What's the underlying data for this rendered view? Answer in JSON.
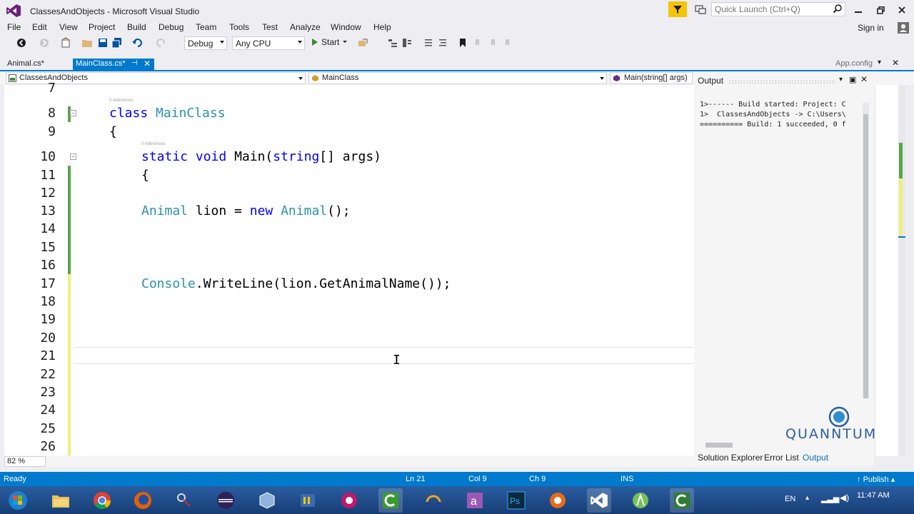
{
  "window": {
    "title": "ClassesAndObjects - Microsoft Visual Studio",
    "quick_launch_placeholder": "Quick Launch (Ctrl+Q)",
    "sign_in": "Sign in"
  },
  "menu": [
    "File",
    "Edit",
    "View",
    "Project",
    "Build",
    "Debug",
    "Team",
    "Tools",
    "Test",
    "Analyze",
    "Window",
    "Help"
  ],
  "toolbar": {
    "configuration": "Debug",
    "platform": "Any CPU",
    "start_label": "Start"
  },
  "doc_tabs": {
    "tab1": "Animal.cs*",
    "tab2": "MainClass.cs*",
    "tab3": "App.config"
  },
  "nav": {
    "project": "ClassesAndObjects",
    "class": "MainClass",
    "member": "Main(string[] args)"
  },
  "editor": {
    "references_hint": "0 references",
    "line_numbers": [
      "7",
      "8",
      "9",
      "10",
      "11",
      "12",
      "13",
      "14",
      "15",
      "16",
      "17",
      "18",
      "19",
      "20",
      "21",
      "22",
      "23",
      "24",
      "25",
      "26"
    ],
    "code": {
      "l8_kw": "class",
      "l8_name": "MainClass",
      "l9": "{",
      "l10_static": "static",
      "l10_void": "void",
      "l10_main": "Main(",
      "l10_string": "string",
      "l10_rest": "[] args)",
      "l11": "{",
      "l13_type": "Animal",
      "l13_mid": " lion = ",
      "l13_new": "new",
      "l13_type2": "Animal",
      "l13_end": "();",
      "l17_type": "Console",
      "l17_rest": ".WriteLine(lion.GetAnimalName());"
    },
    "zoom": "82 %"
  },
  "output": {
    "title": "Output",
    "lines": [
      "1>------ Build started: Project: C",
      "1>  ClassesAndObjects -> C:\\Users\\",
      "========== Build: 1 succeeded, 0 f"
    ],
    "tabs": [
      "Solution Explorer",
      "Error List",
      "Output"
    ]
  },
  "watermark": "QUANNTUM",
  "status": {
    "ready": "Ready",
    "ln": "Ln 21",
    "col": "Col 9",
    "ch": "Ch 9",
    "ins": "INS",
    "publish": "Publish"
  },
  "taskbar": {
    "lang": "EN",
    "clock": "11:47 AM"
  },
  "colors": {
    "accent": "#007acc",
    "keyword": "#0000ff",
    "type": "#2b91af",
    "change_saved": "#57a64a",
    "change_unsaved": "#efef7c"
  }
}
